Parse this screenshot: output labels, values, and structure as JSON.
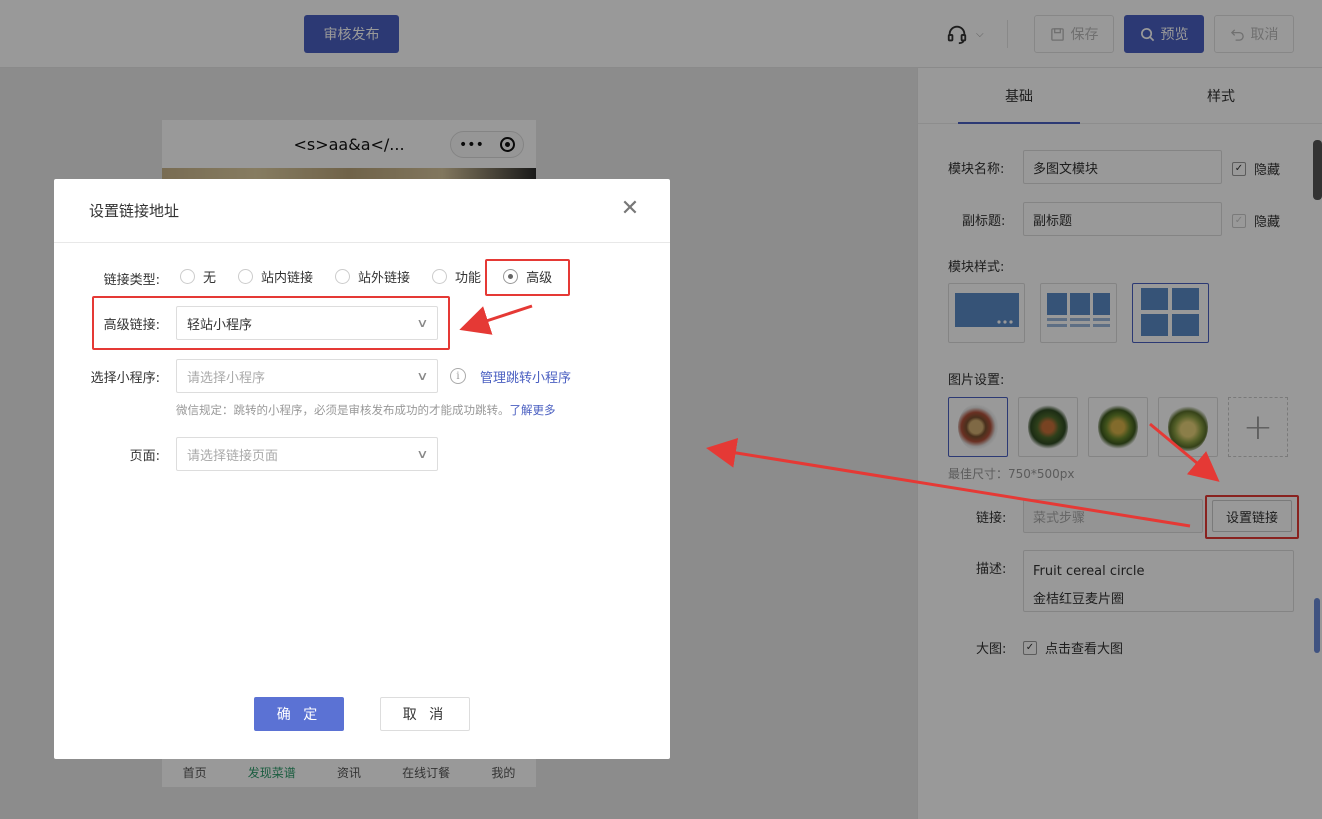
{
  "topbar": {
    "publish_label": "审核发布",
    "save_label": "保存",
    "preview_label": "预览",
    "cancel_label": "取消"
  },
  "phone": {
    "title": "<s>aa&a</...",
    "capsule_more": "•••",
    "tabbar": [
      "首页",
      "发现菜谱",
      "资讯",
      "在线订餐",
      "我的"
    ]
  },
  "panel": {
    "tabs": [
      "基础",
      "样式"
    ],
    "module_name_label": "模块名称:",
    "module_name_value": "多图文模块",
    "subtitle_label": "副标题:",
    "subtitle_placeholder": "副标题",
    "hide_label": "隐藏",
    "module_style_label": "模块样式:",
    "image_settings_label": "图片设置:",
    "best_size": "最佳尺寸：750*500px",
    "link_label": "链接:",
    "link_value": "菜式步骤",
    "set_link_button": "设置链接",
    "desc_label": "描述:",
    "desc_line1": "Fruit cereal circle",
    "desc_line2": "金桔红豆麦片圈",
    "big_image_label": "大图:",
    "big_image_check": "点击查看大图"
  },
  "dialog": {
    "title": "设置链接地址",
    "link_type_label": "链接类型:",
    "link_types": [
      "无",
      "站内链接",
      "站外链接",
      "功能",
      "高级"
    ],
    "selected_link_type": "高级",
    "advanced_link_label": "高级链接:",
    "advanced_link_value": "轻站小程序",
    "mini_program_label": "选择小程序:",
    "mini_program_placeholder": "请选择小程序",
    "manage_link": "管理跳转小程序",
    "wx_note": "微信规定：跳转的小程序，必须是审核发布成功的才能成功跳转。",
    "learn_more": "了解更多",
    "page_label": "页面:",
    "page_placeholder": "请选择链接页面",
    "ok_label": "确 定",
    "cancel_label": "取 消"
  },
  "colors": {
    "accent": "#4a5fc1",
    "annotation": "#e53935"
  }
}
